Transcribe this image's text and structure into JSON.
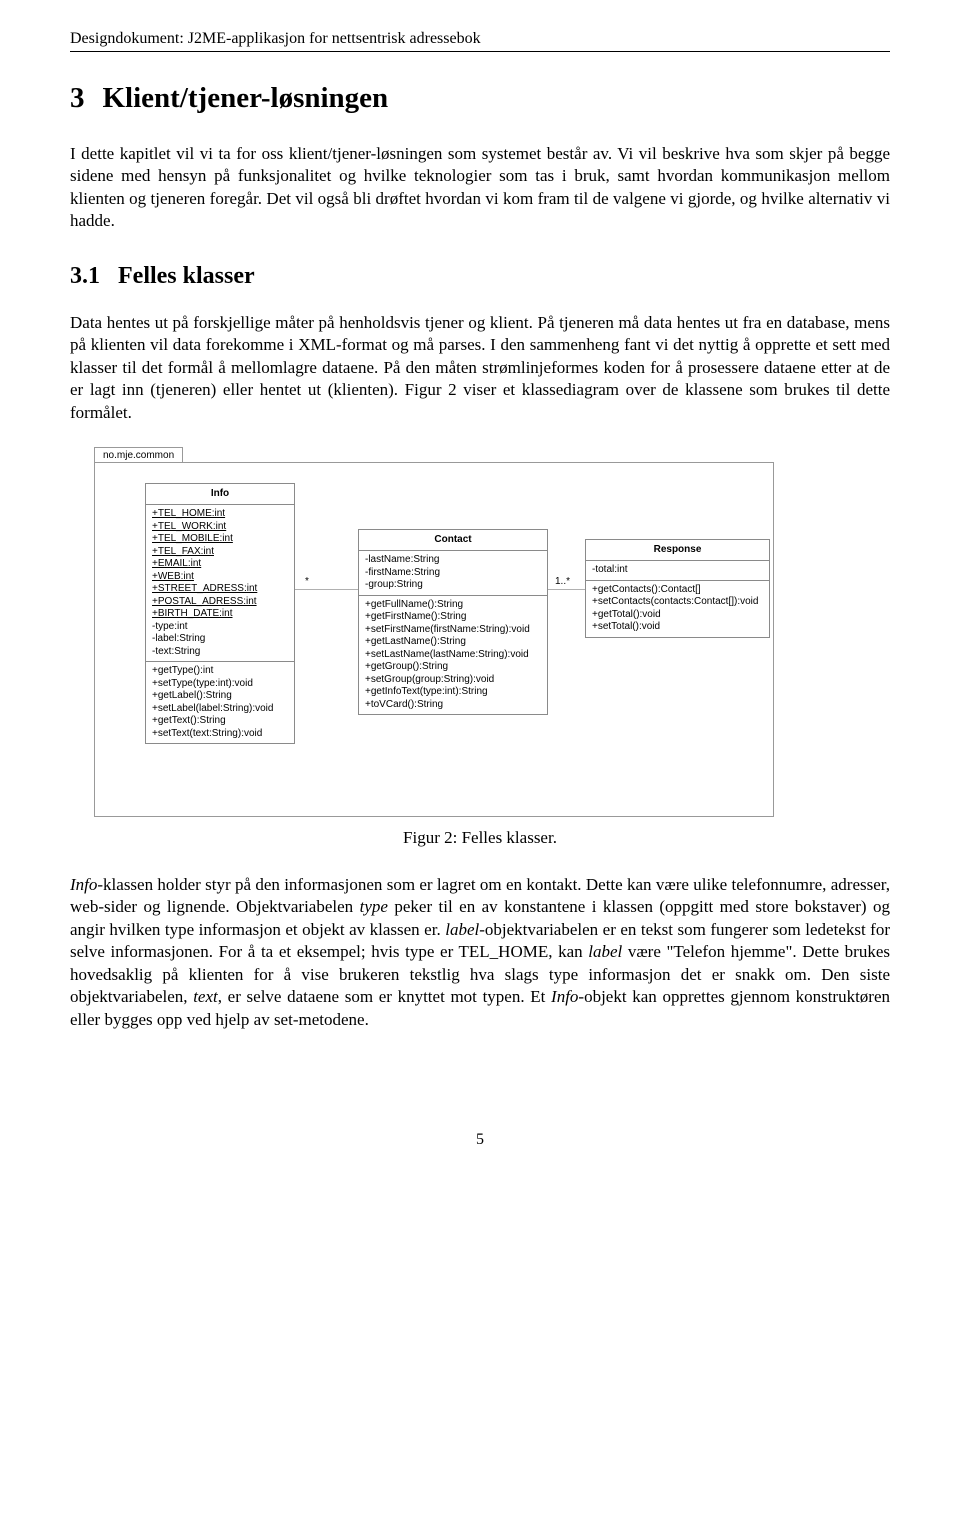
{
  "header": "Designdokument: J2ME-applikasjon for nettsentrisk adressebok",
  "section": {
    "number": "3",
    "title": "Klient/tjener-løsningen"
  },
  "intro_paragraph": "I dette kapitlet vil vi ta for oss klient/tjener-løsningen som systemet består av. Vi vil beskrive hva som skjer på begge sidene med hensyn på funksjonalitet og hvilke teknologier som tas i bruk, samt hvordan kommunikasjon mellom klienten og tjeneren foregår. Det vil også bli drøftet hvordan vi kom fram til de valgene vi gjorde, og hvilke alternativ vi hadde.",
  "subsection": {
    "number": "3.1",
    "title": "Felles klasser"
  },
  "sub_paragraph": "Data hentes ut på forskjellige måter på henholdsvis tjener og klient. På tjeneren må data hentes ut fra en database, mens på klienten vil data forekomme i XML-format og må parses. I den sammenheng fant vi det nyttig å opprette et sett med klasser til det formål å mellomlagre dataene. På den måten strømlinjeformes koden for å prosessere dataene etter at de er lagt inn (tjeneren) eller hentet ut (klienten). Figur 2 viser et klassediagram over de klassene som brukes til dette formålet.",
  "uml": {
    "package": "no.mje.common",
    "mult_left": "*",
    "mult_right": "1..*",
    "info": {
      "name": "Info",
      "attrs": [
        "+TEL_HOME:int",
        "+TEL_WORK:int",
        "+TEL_MOBILE:int",
        "+TEL_FAX:int",
        "+EMAIL:int",
        "+WEB:int",
        "+STREET_ADRESS:int",
        "+POSTAL_ADRESS:int",
        "+BIRTH_DATE:int",
        "-type:int",
        "-label:String",
        "-text:String"
      ],
      "ops": [
        "+getType():int",
        "+setType(type:int):void",
        "+getLabel():String",
        "+setLabel(label:String):void",
        "+getText():String",
        "+setText(text:String):void"
      ]
    },
    "contact": {
      "name": "Contact",
      "attrs": [
        "-lastName:String",
        "-firstName:String",
        "-group:String"
      ],
      "ops": [
        "+getFullName():String",
        "+getFirstName():String",
        "+setFirstName(firstName:String):void",
        "+getLastName():String",
        "+setLastName(lastName:String):void",
        "+getGroup():String",
        "+setGroup(group:String):void",
        "+getInfoText(type:int):String",
        "+toVCard():String"
      ]
    },
    "response": {
      "name": "Response",
      "attrs": [
        "-total:int"
      ],
      "ops": [
        "+getContacts():Contact[]",
        "+setContacts(contacts:Contact[]):void",
        "+getTotal():void",
        "+setTotal():void"
      ]
    }
  },
  "figure_caption": "Figur 2: Felles klasser.",
  "closing_paragraph_prefix_italic": "Info",
  "closing_paragraph_part1": "-klassen holder styr på den informasjonen som er lagret om en kontakt. Dette kan være ulike telefonnumre, adresser, web-sider og lignende. Objektvariabelen ",
  "closing_type_italic": "type",
  "closing_paragraph_part2": " peker til en av konstantene i klassen (oppgitt med store bokstaver) og angir hvilken type informasjon et objekt av klassen er. ",
  "closing_label_italic": "label",
  "closing_paragraph_part3": "-objektvariabelen er en tekst som fungerer som ledetekst for selve informasjonen. For å ta et eksempel; hvis type er TEL_HOME, kan ",
  "closing_label2_italic": "label",
  "closing_paragraph_part4": " være \"Telefon hjemme\". Dette brukes hovedsaklig på klienten for å vise brukeren tekstlig hva slags type informasjon det er snakk om. Den siste objektvariabelen, ",
  "closing_text_italic": "text",
  "closing_paragraph_part5": ", er selve dataene som er knyttet mot typen. Et ",
  "closing_info2_italic": "Info",
  "closing_paragraph_part6": "-objekt kan opprettes gjennom konstruktøren eller bygges opp ved hjelp av set-metodene.",
  "page_number": "5"
}
